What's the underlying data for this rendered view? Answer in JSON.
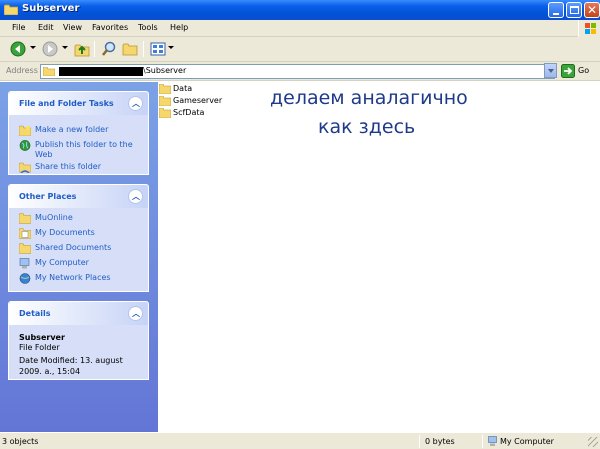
{
  "window": {
    "title": "Subserver"
  },
  "menu": [
    "File",
    "Edit",
    "View",
    "Favorites",
    "Tools",
    "Help"
  ],
  "address": {
    "label": "Address",
    "path_visible": "\\Subserver",
    "go_label": "Go"
  },
  "tasks_panel": {
    "title": "File and Folder Tasks",
    "items": [
      "Make a new folder",
      "Publish this folder to the Web",
      "Share this folder"
    ]
  },
  "places_panel": {
    "title": "Other Places",
    "items": [
      "MuOnline",
      "My Documents",
      "Shared Documents",
      "My Computer",
      "My Network Places"
    ]
  },
  "details_panel": {
    "title": "Details",
    "name": "Subserver",
    "type": "File Folder",
    "date": "Date Modified: 13. august 2009. a., 15:04"
  },
  "files": [
    "Data",
    "Gameserver",
    "ScfData"
  ],
  "annotation": {
    "line1": "делаем аналагично",
    "line2": "как здесь"
  },
  "status": {
    "objects": "3 objects",
    "size": "0 bytes",
    "location": "My Computer"
  },
  "colors": {
    "title_bar": "#0a5fe8",
    "task_pane": "#7ba2e7",
    "link": "#215dc6",
    "annotation": "#1f3a8a"
  }
}
